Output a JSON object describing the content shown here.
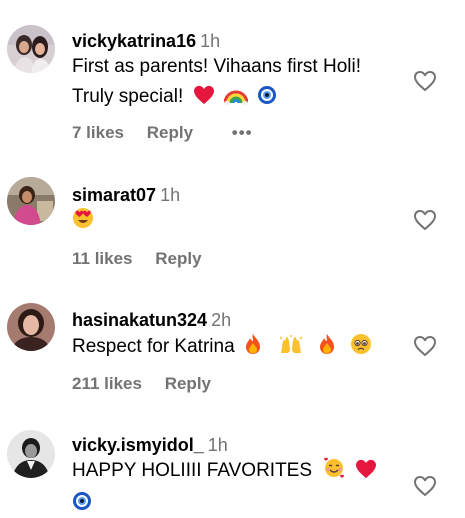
{
  "comments": [
    {
      "username": "vickykatrina16",
      "time": "1h",
      "text_line1": "First as parents! Vihaans first Holi!",
      "text_line2": "Truly special!",
      "emojis": [
        "red-heart",
        "rainbow",
        "nazar-amulet"
      ],
      "likes": "7 likes",
      "reply": "Reply",
      "more": "•••"
    },
    {
      "username": "simarat07",
      "time": "1h",
      "emojis": [
        "heart-eyes-face"
      ],
      "likes": "11 likes",
      "reply": "Reply"
    },
    {
      "username": "hasinakatun324",
      "time": "2h",
      "text": "Respect for Katrina",
      "emojis": [
        "fire",
        "raising-hands",
        "fire",
        "pleading-face"
      ],
      "likes": "211 likes",
      "reply": "Reply"
    },
    {
      "username": "vicky.ismyidol_",
      "time": "1h",
      "text": "HAPPY HOLIIII FAVORITES",
      "emojis": [
        "smiling-face-with-hearts",
        "red-heart",
        "nazar-amulet"
      ]
    }
  ],
  "colors": {
    "secondary_text": "#737373",
    "heart_outline": "#737373",
    "emoji_red": "#e5173f"
  }
}
